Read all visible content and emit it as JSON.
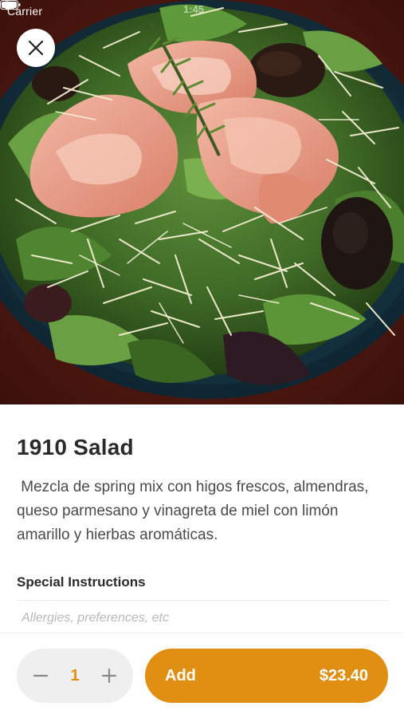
{
  "status_bar": {
    "carrier": "Carrier",
    "time": "1:45"
  },
  "hero": {
    "image_subject": "salad-photo",
    "close_icon": "close-icon"
  },
  "item": {
    "title": "1910 Salad",
    "description": " Mezcla de spring mix con higos frescos, almendras, queso parmesano y vinagreta de miel con limón amarillo y hierbas aromáticas."
  },
  "special_instructions": {
    "label": "Special Instructions",
    "value": "",
    "placeholder": "Allergies, preferences, etc"
  },
  "order": {
    "quantity": "1",
    "add_label": "Add",
    "price": "$23.40"
  },
  "colors": {
    "accent": "#e08f13",
    "stepper_bg": "#efefef",
    "title": "#2a2a2a",
    "body_text": "#4a4a4a"
  }
}
